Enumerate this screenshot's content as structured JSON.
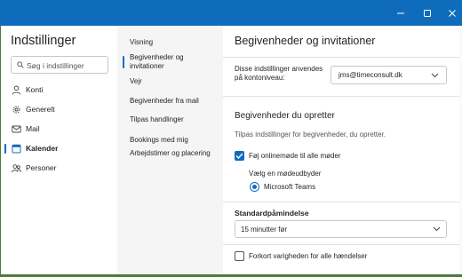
{
  "window": {
    "controls": {
      "minimize": "—",
      "maximize": "☐",
      "close": "✕"
    },
    "accent": "#0f6cbd"
  },
  "sidebar": {
    "title": "Indstillinger",
    "search_placeholder": "Søg i indstillinger",
    "items": [
      {
        "label": "Konti",
        "icon": "person-icon"
      },
      {
        "label": "Generelt",
        "icon": "gear-icon"
      },
      {
        "label": "Mail",
        "icon": "mail-icon"
      },
      {
        "label": "Kalender",
        "icon": "calendar-icon",
        "active": true
      },
      {
        "label": "Personer",
        "icon": "people-icon"
      }
    ]
  },
  "subnav": {
    "items": [
      {
        "label": "Visning"
      },
      {
        "label": "Begivenheder og invitationer",
        "active": true
      },
      {
        "label": "Vejr"
      },
      {
        "label": "Begivenheder fra mail"
      },
      {
        "label": "Tilpas handlinger"
      },
      {
        "label": "Bookings med mig"
      },
      {
        "label": "Arbejdstimer og placering"
      }
    ]
  },
  "main": {
    "title": "Begivenheder og invitationer",
    "account_label": "Disse indstillinger anvendes på kontoniveau:",
    "account_value": "jms@timeconsult.dk",
    "section_title": "Begivenheder du opretter",
    "section_desc": "Tilpas indstillinger for begivenheder, du opretter.",
    "online_meeting": {
      "label": "Føj onlinemøde til alle møder",
      "checked": true
    },
    "provider_label": "Vælg en mødeudbyder",
    "provider_option": {
      "label": "Microsoft Teams",
      "selected": true
    },
    "duration_label": "Standardpåmindelse",
    "duration_value": "15 minutter før",
    "shorten": {
      "label": "Forkort varigheden for alle hændelser",
      "checked": false
    }
  }
}
